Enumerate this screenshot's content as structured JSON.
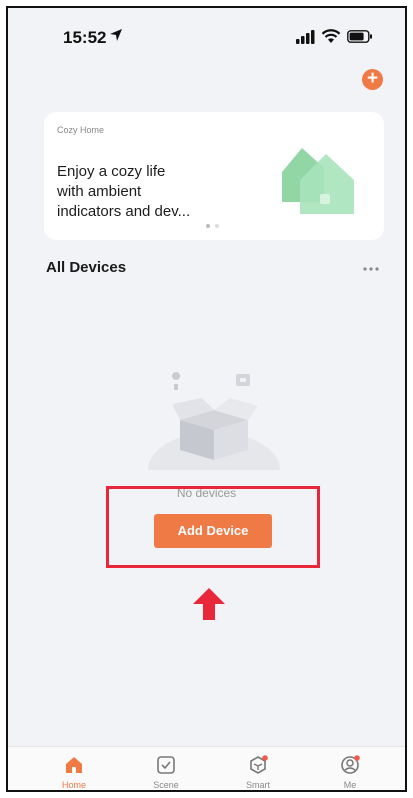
{
  "status_bar": {
    "time": "15:52"
  },
  "header": {
    "add_button": "+"
  },
  "banner": {
    "small_title": "Cozy Home",
    "lines": [
      "Enjoy a cozy life",
      "with ambient",
      "indicators and dev..."
    ]
  },
  "devices": {
    "title": "All Devices",
    "empty_text": "No devices",
    "add_button": "Add Device"
  },
  "tabbar": {
    "items": [
      {
        "label": "Home",
        "icon": "home-icon",
        "active": true
      },
      {
        "label": "Scene",
        "icon": "checkbox-icon",
        "active": false
      },
      {
        "label": "Smart",
        "icon": "cube-icon",
        "active": false
      },
      {
        "label": "Me",
        "icon": "profile-icon",
        "active": false
      }
    ]
  },
  "colors": {
    "accent": "#f07a45",
    "highlight": "#e8283a",
    "background": "#f2f3f7"
  }
}
